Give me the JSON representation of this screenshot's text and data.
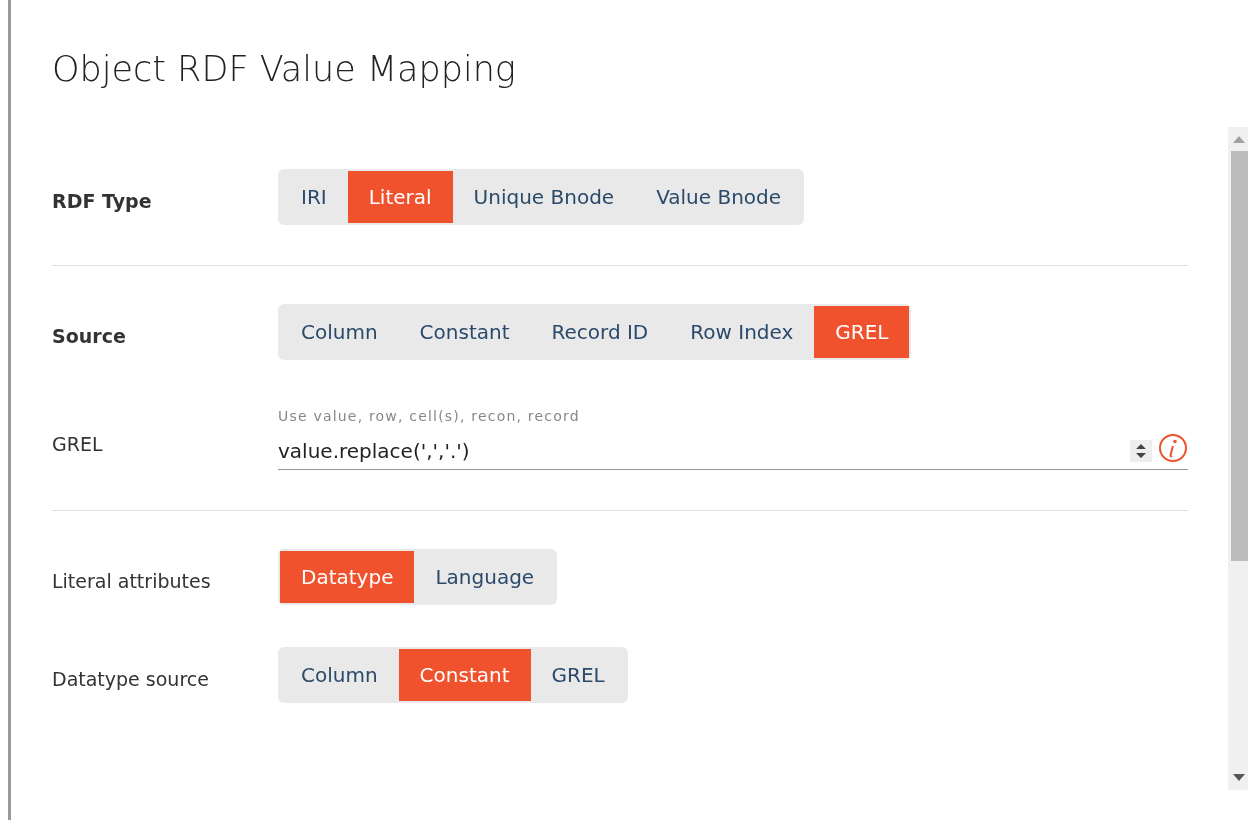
{
  "dialog": {
    "title": "Object RDF Value Mapping"
  },
  "sections": [
    {
      "rows": [
        {
          "kind": "toggle",
          "label": "RDF Type",
          "emphasized": true,
          "options": [
            {
              "label": "IRI",
              "selected": false
            },
            {
              "label": "Literal",
              "selected": true
            },
            {
              "label": "Unique Bnode",
              "selected": false
            },
            {
              "label": "Value Bnode",
              "selected": false
            }
          ]
        }
      ]
    },
    {
      "rows": [
        {
          "kind": "toggle",
          "label": "Source",
          "emphasized": true,
          "options": [
            {
              "label": "Column",
              "selected": false
            },
            {
              "label": "Constant",
              "selected": false
            },
            {
              "label": "Record ID",
              "selected": false
            },
            {
              "label": "Row Index",
              "selected": false
            },
            {
              "label": "GREL",
              "selected": true
            }
          ]
        },
        {
          "kind": "expression",
          "label": "GREL",
          "emphasized": false,
          "hint": "Use value, row, cell(s), recon, record",
          "value": "value.replace(',','.')"
        }
      ]
    },
    {
      "rows": [
        {
          "kind": "toggle",
          "label": "Literal attributes",
          "emphasized": false,
          "options": [
            {
              "label": "Datatype",
              "selected": true
            },
            {
              "label": "Language",
              "selected": false
            }
          ]
        },
        {
          "kind": "toggle",
          "label": "Datatype source",
          "emphasized": false,
          "options": [
            {
              "label": "Column",
              "selected": false
            },
            {
              "label": "Constant",
              "selected": true
            },
            {
              "label": "GREL",
              "selected": false
            }
          ]
        }
      ]
    }
  ]
}
